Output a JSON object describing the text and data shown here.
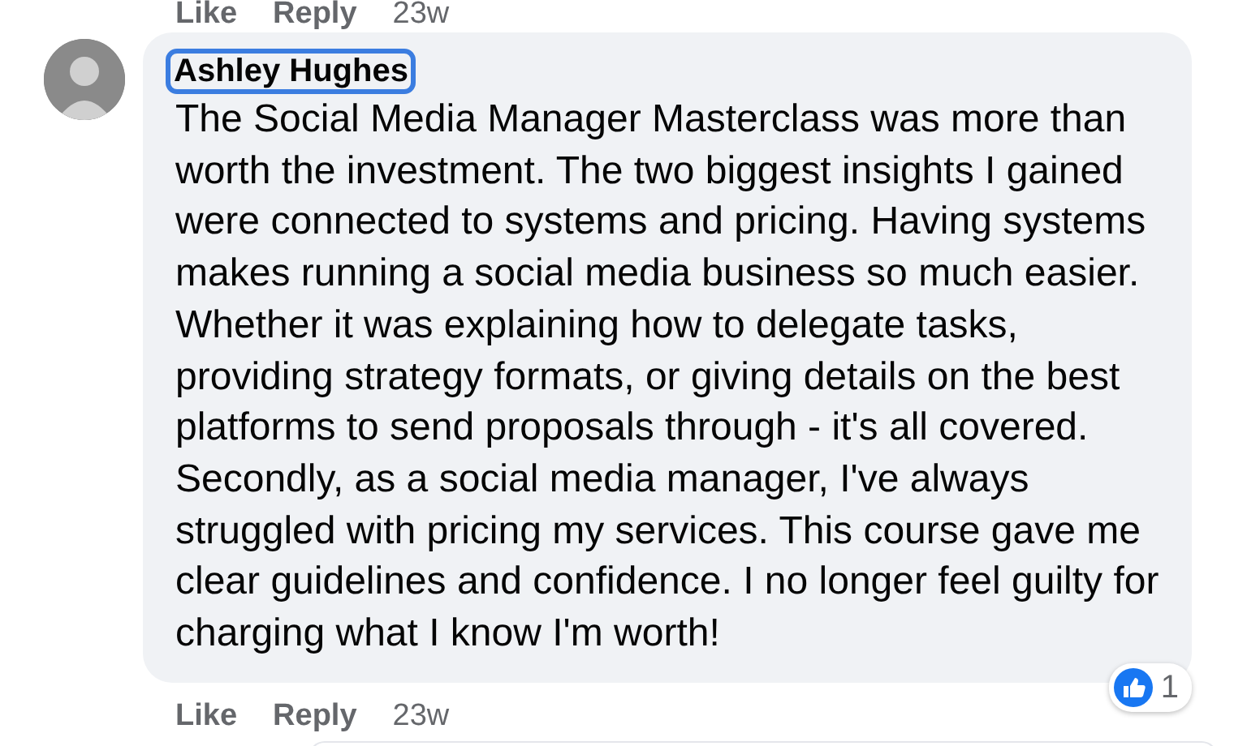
{
  "previous_comment_actions": {
    "like": "Like",
    "reply": "Reply",
    "time": "23w"
  },
  "comment": {
    "author": "Ashley Hughes",
    "author_focused": true,
    "text": "The Social Media Manager Masterclass was more than worth the investment. The two biggest insights I gained were connected to systems and pricing. Having systems makes running a social media business so much easier. Whether it was explaining how to delegate tasks, providing strategy formats, or giving details on the best platforms to send proposals through - it's all covered. Secondly, as a social media manager, I've always struggled with pricing my services. This course gave me clear guidelines and confidence. I no longer feel guilty for charging what I know I'm worth!",
    "reaction_count": "1",
    "actions": {
      "like": "Like",
      "reply": "Reply",
      "time": "23w"
    }
  }
}
